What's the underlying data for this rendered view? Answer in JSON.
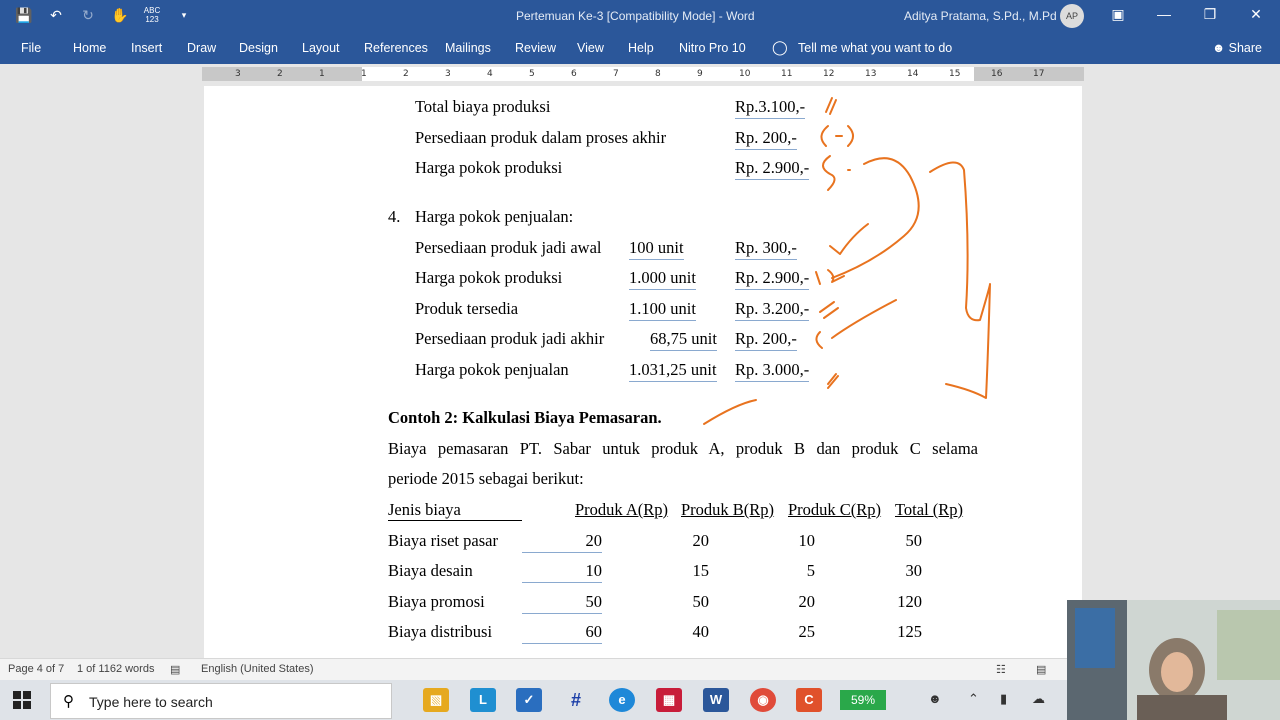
{
  "titlebar": {
    "doc_title": "Pertemuan Ke-3 [Compatibility Mode]  -  Word",
    "user": "Aditya Pratama, S.Pd., M.Pd",
    "initials": "AP"
  },
  "menu": [
    "File",
    "Home",
    "Insert",
    "Draw",
    "Design",
    "Layout",
    "References",
    "Mailings",
    "Review",
    "View",
    "Help",
    "Nitro Pro 10"
  ],
  "tell_me": "Tell me what you want to do",
  "share": "Share",
  "ruler_marks": [
    "3",
    "2",
    "1",
    "1",
    "2",
    "3",
    "4",
    "5",
    "6",
    "7",
    "8",
    "9",
    "10",
    "11",
    "12",
    "13",
    "14",
    "15",
    "16",
    "17"
  ],
  "doc": {
    "section3": [
      {
        "label": "Total biaya produksi",
        "amount": "Rp.3.100,-"
      },
      {
        "label": "Persediaan produk dalam proses akhir",
        "amount": "Rp.   200,-"
      },
      {
        "label": "Harga pokok produksi",
        "amount": "Rp. 2.900,-"
      }
    ],
    "section4_num": "4.",
    "section4_title": "Harga pokok penjualan:",
    "section4": [
      {
        "label": "Persediaan produk jadi awal",
        "unit": "100 unit",
        "amount": "Rp.    300,-"
      },
      {
        "label": "Harga pokok produksi",
        "unit": "1.000 unit",
        "amount": "Rp. 2.900,-"
      },
      {
        "label": "Produk tersedia",
        "unit": "1.100 unit",
        "amount": "Rp. 3.200,-"
      },
      {
        "label": "Persediaan produk jadi akhir",
        "unit": "68,75 unit",
        "amount": "Rp.    200,-"
      },
      {
        "label": "Harga pokok penjualan",
        "unit": "1.031,25 unit",
        "amount": "Rp. 3.000,-"
      }
    ],
    "contoh_title": "Contoh 2: Kalkulasi Biaya Pemasaran.",
    "para_line1": "Biaya pemasaran PT. Sabar untuk produk A, produk B dan produk C selama",
    "para_line2": "periode 2015 sebagai berikut:",
    "table_headers": [
      "Jenis biaya",
      "Produk A(Rp)",
      "Produk B(Rp)",
      "Produk C(Rp)",
      "Total (Rp)"
    ],
    "table_rows": [
      {
        "name": "Biaya riset pasar",
        "a": "20",
        "b": "20",
        "c": "10",
        "t": "50"
      },
      {
        "name": "Biaya desain",
        "a": "10",
        "b": "15",
        "c": "5",
        "t": "30"
      },
      {
        "name": "Biaya promosi",
        "a": "50",
        "b": "50",
        "c": "20",
        "t": "120"
      },
      {
        "name": "Biaya distribusi",
        "a": "60",
        "b": "40",
        "c": "25",
        "t": "125"
      }
    ]
  },
  "status": {
    "page": "Page 4 of 7",
    "words": "1 of 1162 words",
    "language": "English (United States)"
  },
  "taskbar": {
    "search_placeholder": "Type here to search",
    "battery": "59%"
  },
  "colors": {
    "word_blue": "#2b579a",
    "ink_orange": "#e8731f"
  }
}
